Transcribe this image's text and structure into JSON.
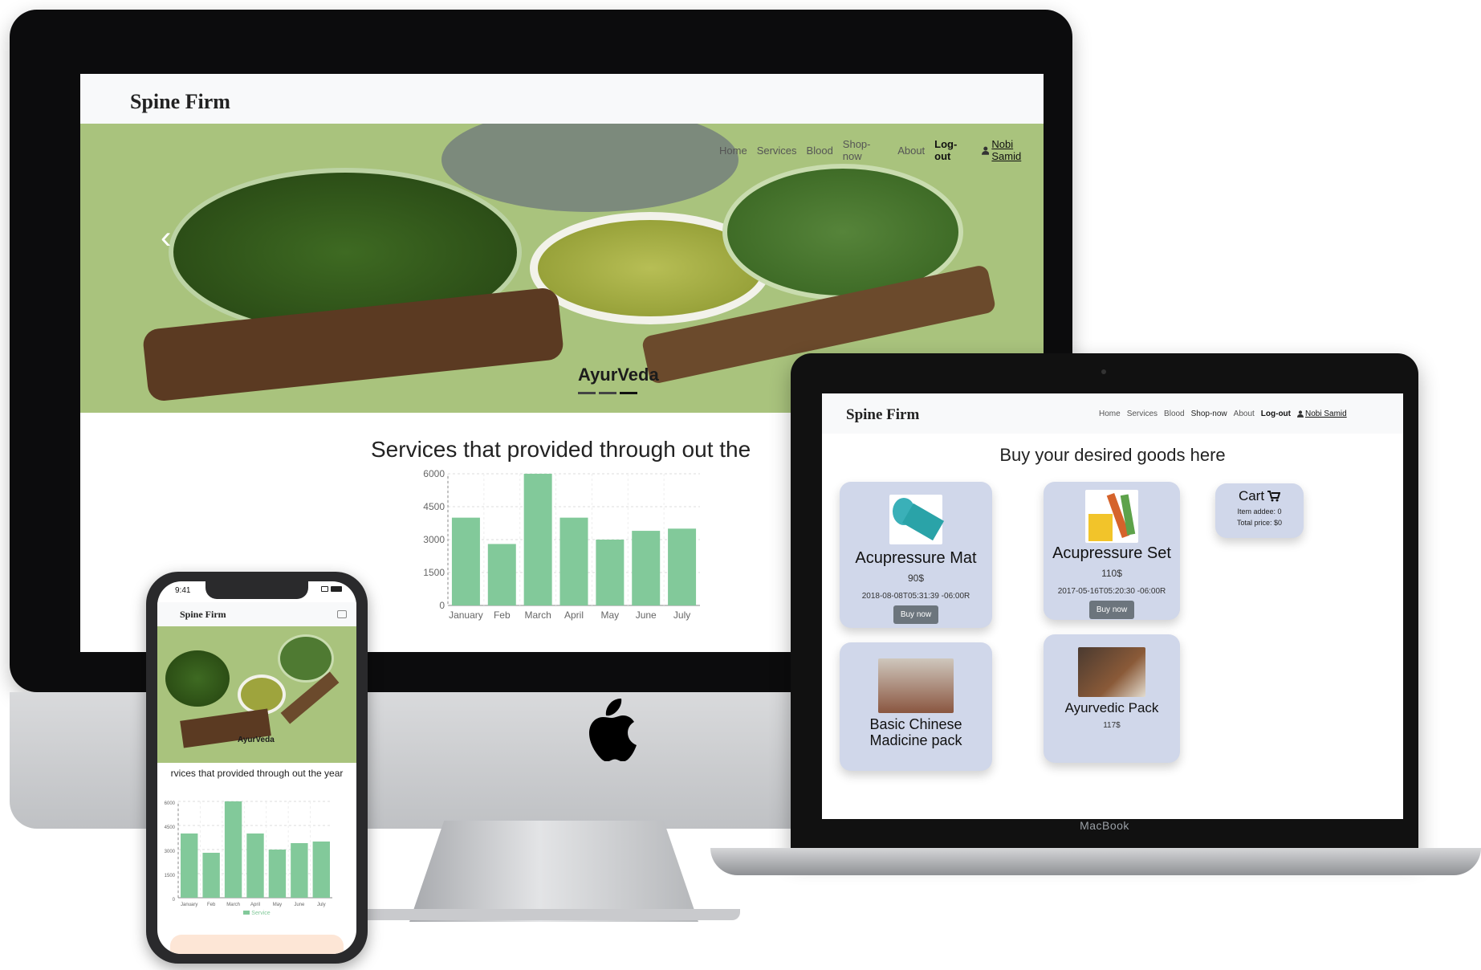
{
  "site": {
    "brand": "Spine Firm",
    "nav": [
      "Home",
      "Services",
      "Blood",
      "Shop-now",
      "About"
    ],
    "logout": "Log-out",
    "user": "Nobi Samid"
  },
  "desktop": {
    "hero_caption": "AyurVeda",
    "section_title": "Services that provided through out the"
  },
  "chart_data": {
    "type": "bar",
    "categories": [
      "January",
      "Feb",
      "March",
      "April",
      "May",
      "June",
      "July"
    ],
    "values": [
      4000,
      2800,
      6000,
      4000,
      3000,
      3400,
      3500
    ],
    "ylim": [
      0,
      6000
    ],
    "yticks": [
      "0",
      "1500",
      "3000",
      "4500",
      "6000"
    ],
    "grid": true,
    "bar_color": "#82c99a"
  },
  "laptop": {
    "title": "Buy your desired goods here",
    "products": [
      {
        "name": "Acupressure Mat",
        "price": "90$",
        "date": "2018-08-08T05:31:39 -06:00R",
        "button": "Buy now"
      },
      {
        "name": "Acupressure Set",
        "price": "110$",
        "date": "2017-05-16T05:20:30 -06:00R",
        "button": "Buy now"
      },
      {
        "name": "Basic Chinese Madicine pack",
        "price": "",
        "date": "",
        "button": ""
      },
      {
        "name": "Ayurvedic Pack",
        "price": "117$",
        "date": "",
        "button": ""
      }
    ],
    "cart": {
      "title": "Cart",
      "items": "Item addee: 0",
      "total": "Total price: $0"
    },
    "device_label": "MacBook"
  },
  "phone": {
    "time": "9:41",
    "hero_caption": "AyurVeda",
    "section_title": "rvices that provided through out the year",
    "yticks": [
      "0",
      "1500",
      "3000",
      "4500",
      "6000"
    ],
    "legend": "Service"
  },
  "colors": {
    "card_bg": "#d0d7ea",
    "bar": "#82c99a",
    "hero_bg": "#a9c37d",
    "button": "#6c757d"
  }
}
